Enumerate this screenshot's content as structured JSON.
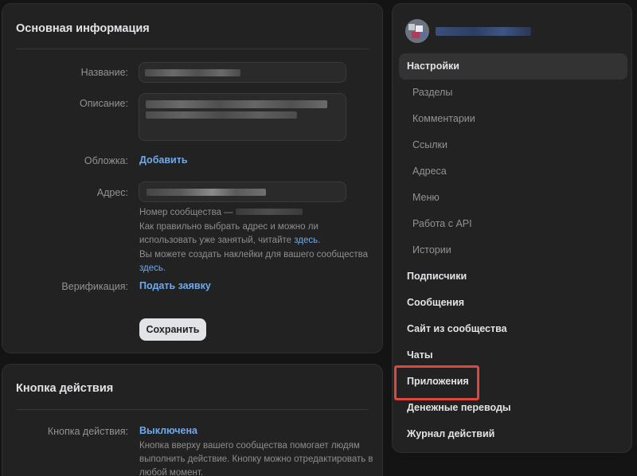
{
  "main": {
    "title": "Основная информация",
    "name_label": "Название:",
    "desc_label": "Описание:",
    "cover_label": "Обложка:",
    "cover_link": "Добавить",
    "address_label": "Адрес:",
    "community_number_prefix": "Номер сообщества —",
    "address_hint_1": "Как правильно выбрать адрес и можно ли",
    "address_hint_2": "использовать уже занятый, читайте",
    "address_hint_link": "здесь",
    "sticker_hint": "Вы можете создать наклейки для вашего сообщества",
    "sticker_link": "здесь",
    "verify_label": "Верификация:",
    "verify_link": "Подать заявку",
    "save_button": "Сохранить"
  },
  "action": {
    "title": "Кнопка действия",
    "button_label": "Кнопка действия:",
    "button_value": "Выключена",
    "hint_1": "Кнопка вверху вашего сообщества помогает людям",
    "hint_2": "выполнить действие. Кнопку можно отредактировать в",
    "hint_3": "любой момент."
  },
  "nav": {
    "items": [
      {
        "label": "Настройки",
        "type": "active"
      },
      {
        "label": "Разделы",
        "type": "sub"
      },
      {
        "label": "Комментарии",
        "type": "sub"
      },
      {
        "label": "Ссылки",
        "type": "sub"
      },
      {
        "label": "Адреса",
        "type": "sub"
      },
      {
        "label": "Меню",
        "type": "sub"
      },
      {
        "label": "Работа с API",
        "type": "sub"
      },
      {
        "label": "Истории",
        "type": "sub"
      },
      {
        "label": "Подписчики",
        "type": "bold"
      },
      {
        "label": "Сообщения",
        "type": "bold"
      },
      {
        "label": "Сайт из сообщества",
        "type": "bold"
      },
      {
        "label": "Чаты",
        "type": "bold"
      },
      {
        "label": "Приложения",
        "type": "bold"
      },
      {
        "label": "Денежные переводы",
        "type": "bold"
      },
      {
        "label": "Журнал действий",
        "type": "bold"
      }
    ],
    "highlighted_item": "Приложения"
  },
  "colors": {
    "link": "#71aaeb",
    "highlight": "#e0463c",
    "card_bg": "#222222",
    "page_bg": "#141414"
  }
}
